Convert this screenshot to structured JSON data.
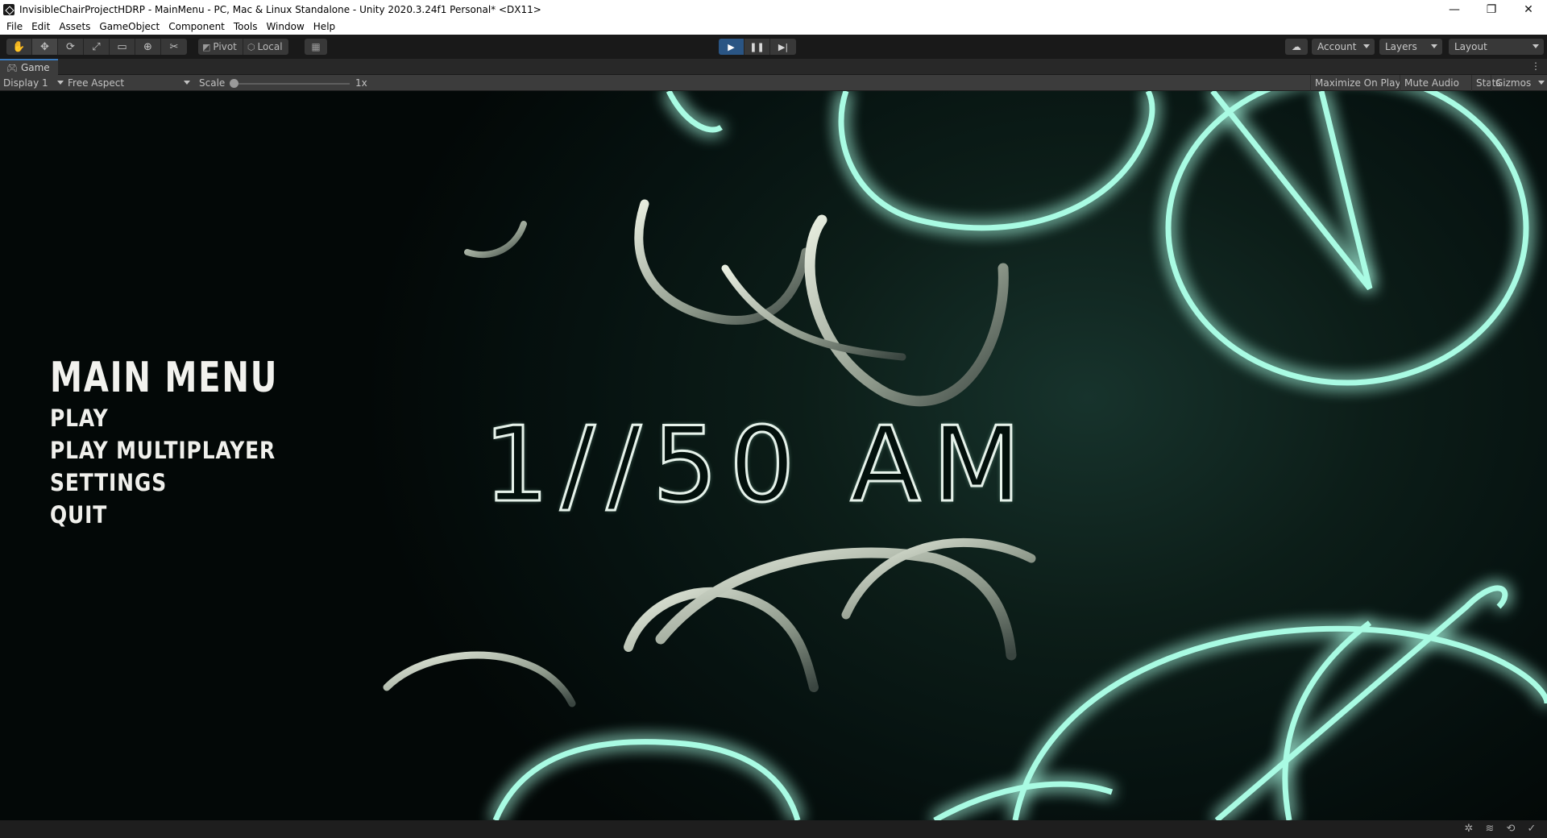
{
  "window": {
    "title": "InvisibleChairProjectHDRP - MainMenu - PC, Mac & Linux Standalone - Unity 2020.3.24f1 Personal* <DX11>",
    "controls": [
      "—",
      "❐",
      "✕"
    ]
  },
  "menubar": {
    "items": [
      "File",
      "Edit",
      "Assets",
      "GameObject",
      "Component",
      "Tools",
      "Window",
      "Help"
    ]
  },
  "toolbar": {
    "pivot_label": "Pivot",
    "local_label": "Local",
    "account_label": "Account",
    "layers_label": "Layers",
    "layout_label": "Layout",
    "play_state": "playing"
  },
  "game_view": {
    "tab_label": "Game",
    "display_label": "Display 1",
    "aspect_label": "Free Aspect",
    "scale_label": "Scale",
    "scale_value": "1x",
    "maximize_label": "Maximize On Play",
    "mute_label": "Mute Audio",
    "stats_label": "Stats",
    "gizmos_label": "Gizmos"
  },
  "game": {
    "menu_title": "MAIN MENU",
    "options": [
      "PLAY",
      "PLAY MULTIPLAYER",
      "SETTINGS",
      "QUIT"
    ],
    "logo_text": "1//50 AM"
  },
  "colors": {
    "neon": "#8ff5d8",
    "play_active": "#2a5584",
    "tab_accent": "#3a79bb"
  }
}
